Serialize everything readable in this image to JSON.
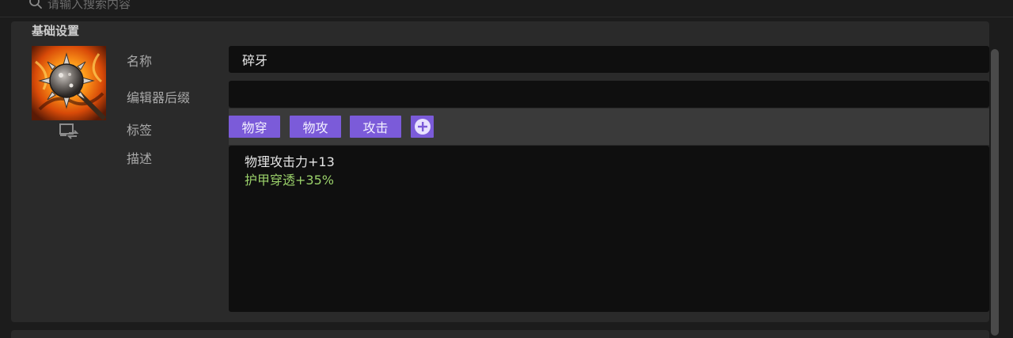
{
  "search": {
    "placeholder": "请输入搜索内容",
    "icon": "search-icon"
  },
  "section": {
    "title": "基础设置"
  },
  "item": {
    "image_alt": "spiked-mace-fire-icon",
    "swap_icon": "swap-image-icon"
  },
  "fields": {
    "name_label": "名称",
    "name_value": "碎牙",
    "suffix_label": "编辑器后缀",
    "suffix_value": "",
    "tags_label": "标签",
    "desc_label": "描述"
  },
  "tags": [
    "物穿",
    "物攻",
    "攻击"
  ],
  "description": {
    "line1": "物理攻击力+13",
    "line2": "护甲穿透+35%"
  },
  "colors": {
    "accent": "#7b5bd9",
    "bonus_text": "#9ad06a",
    "field_bg": "#0f0f0f"
  }
}
